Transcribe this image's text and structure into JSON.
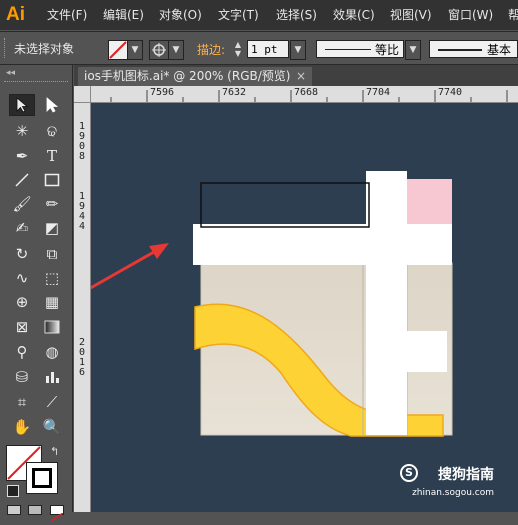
{
  "app": {
    "logo": "Ai"
  },
  "menu": [
    "文件(F)",
    "编辑(E)",
    "对象(O)",
    "文字(T)",
    "选择(S)",
    "效果(C)",
    "视图(V)",
    "窗口(W)",
    "帮"
  ],
  "controlbar": {
    "selection_status": "未选择对象",
    "stroke_label": "描边:",
    "stroke_weight": "1 pt",
    "profile_label": "等比",
    "brush_label": "基本"
  },
  "document_tab": {
    "title": "ios手机图标.ai* @ 200% (RGB/预览)",
    "close": "×"
  },
  "ruler": {
    "horizontal": [
      "7596",
      "7632",
      "7668",
      "7704",
      "7740"
    ],
    "vertical": [
      "1908",
      "1944",
      "2016"
    ]
  },
  "colors": {
    "canvas": "#2c3e50",
    "yellow": "#fdd235",
    "pink": "#f7c8d2",
    "beige": "#e2dbcd",
    "arrow": "#e53935",
    "ui_orange": "#ff9a00"
  },
  "watermark": {
    "text": "搜狗指南",
    "url": "zhinan.sogou.com"
  }
}
